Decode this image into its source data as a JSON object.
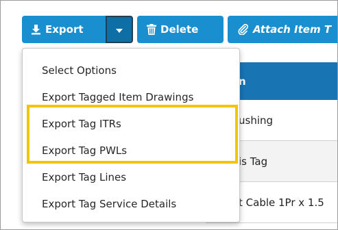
{
  "toolbar": {
    "export_label": "Export",
    "delete_label": "Delete",
    "attach_label": "Attach Item T"
  },
  "table": {
    "header_label": "n",
    "rows": [
      "ushing",
      "is Tag",
      "t Cable 1Pr x 1.5"
    ]
  },
  "dropdown": {
    "items": [
      "Select Options",
      "Export Tagged Item Drawings",
      "Export Tag ITRs",
      "Export Tag PWLs",
      "Export Tag Lines",
      "Export Tag Service Details"
    ]
  },
  "colors": {
    "button_blue": "#1a8fd0",
    "button_dark": "#0d6fa6",
    "header_blue": "#1874b3",
    "highlight_yellow": "#f5c400"
  },
  "icons": {
    "export": "download-icon",
    "caret": "caret-down-icon",
    "delete": "trash-icon",
    "attach": "paperclip-icon"
  }
}
